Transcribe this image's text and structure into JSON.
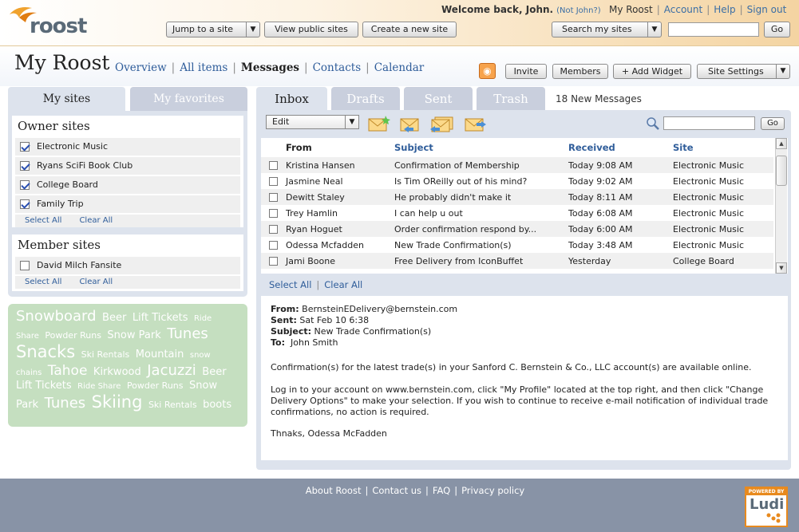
{
  "header": {
    "logo_text": "roost",
    "welcome": "Welcome back, John.",
    "not_john": "(Not John?)",
    "links": [
      "My Roost",
      "Account",
      "Help",
      "Sign out"
    ],
    "buttons": {
      "jump": "Jump to a site",
      "view_public": "View public sites",
      "create": "Create a new site",
      "search_sites": "Search my sites",
      "go": "Go"
    },
    "search_value": ""
  },
  "page": {
    "title": "My Roost",
    "nav": [
      "Overview",
      "All items",
      "Messages",
      "Contacts",
      "Calendar"
    ],
    "current_nav": "Messages",
    "actions": {
      "invite": "Invite",
      "members": "Members",
      "add_widget": "+ Add Widget",
      "site_settings": "Site Settings"
    }
  },
  "left": {
    "tabs": [
      "My sites",
      "My favorites"
    ],
    "owner_title": "Owner sites",
    "owner_sites": [
      {
        "name": "Electronic Music",
        "checked": true
      },
      {
        "name": "Ryans SciFi Book Club",
        "checked": true
      },
      {
        "name": "College Board",
        "checked": true
      },
      {
        "name": "Family Trip",
        "checked": true
      }
    ],
    "member_title": "Member sites",
    "member_sites": [
      {
        "name": "David Milch Fansite",
        "checked": false
      }
    ],
    "select_all": "Select All",
    "clear_all": "Clear All",
    "tags": [
      {
        "t": "Snowboard",
        "s": 18
      },
      {
        "t": "Beer",
        "s": 13
      },
      {
        "t": "Lift Tickets",
        "s": 13
      },
      {
        "t": "Ride",
        "s": 10
      },
      {
        "t": "Share",
        "s": 10
      },
      {
        "t": "Powder Runs",
        "s": 11
      },
      {
        "t": "Snow Park",
        "s": 13
      },
      {
        "t": "Tunes",
        "s": 18
      },
      {
        "t": "Snacks",
        "s": 21
      },
      {
        "t": "Ski Rentals",
        "s": 11
      },
      {
        "t": "Mountain",
        "s": 13
      },
      {
        "t": "snow chains",
        "s": 10
      },
      {
        "t": "Tahoe",
        "s": 17
      },
      {
        "t": "Kirkwood",
        "s": 13
      },
      {
        "t": "Jacuzzi",
        "s": 18
      },
      {
        "t": "Beer",
        "s": 13
      },
      {
        "t": "Lift Tickets",
        "s": 13
      },
      {
        "t": "Ride Share",
        "s": 10
      },
      {
        "t": "Powder Runs",
        "s": 11
      },
      {
        "t": "Snow Park",
        "s": 13
      },
      {
        "t": "Tunes",
        "s": 18
      },
      {
        "t": "Skiing",
        "s": 21
      },
      {
        "t": "Ski Rentals",
        "s": 11
      },
      {
        "t": "boots",
        "s": 13
      }
    ]
  },
  "messages": {
    "tabs": [
      "Inbox",
      "Drafts",
      "Sent",
      "Trash"
    ],
    "new_count": "18 New Messages",
    "edit_label": "Edit",
    "go": "Go",
    "search_value": "",
    "columns": [
      "From",
      "Subject",
      "Received",
      "Site"
    ],
    "rows": [
      {
        "from": "Kristina Hansen",
        "subject": "Confirmation of Membership",
        "received": "Today 9:08 AM",
        "site": "Electronic Music"
      },
      {
        "from": "Jasmine Neal",
        "subject": "Is Tim OReilly out of his mind?",
        "received": "Today 9:02 AM",
        "site": "Electronic Music"
      },
      {
        "from": "Dewitt Staley",
        "subject": "He probably didn't make it",
        "received": "Today 8:11 AM",
        "site": "Electronic Music"
      },
      {
        "from": "Trey Hamlin",
        "subject": "I can help u out",
        "received": "Today 6:08 AM",
        "site": "Electronic Music"
      },
      {
        "from": "Ryan Hoguet",
        "subject": "Order confirmation respond by...",
        "received": "Today 6:00 AM",
        "site": "Electronic Music"
      },
      {
        "from": "Odessa Mcfadden",
        "subject": "New Trade Confirmation(s)",
        "received": "Today 3:48 AM",
        "site": "Electronic Music"
      },
      {
        "from": "Jami Boone",
        "subject": "Free Delivery from IconBuffet",
        "received": "Yesterday",
        "site": "College Board"
      }
    ],
    "select_all": "Select All",
    "clear_all": "Clear All",
    "reader": {
      "from_label": "From:",
      "from": "BernsteinEDelivery@bernstein.com",
      "sent_label": "Sent:",
      "sent": "Sat Feb 10 6:38",
      "subject_label": "Subject:",
      "subject": "New Trade Confirmation(s)",
      "to_label": "To:",
      "to": "John Smith",
      "p1": "Confirmation(s) for the latest trade(s) in your Sanford C. Bernstein & Co., LLC account(s) are available online.",
      "p2": "Log in to your account on www.bernstein.com, click \"My Profile\" located at the top right, and then click \"Change Delivery Options\"  to make your selection. If you wish to continue to receive e-mail notification of individual trade confirmations, no action is required.",
      "p3": "Thnaks, Odessa McFadden"
    }
  },
  "footer": {
    "links": [
      "About Roost",
      "Contact us",
      "FAQ",
      "Privacy policy"
    ],
    "badge_top": "POWERED BY",
    "badge_text": "Ludi"
  }
}
